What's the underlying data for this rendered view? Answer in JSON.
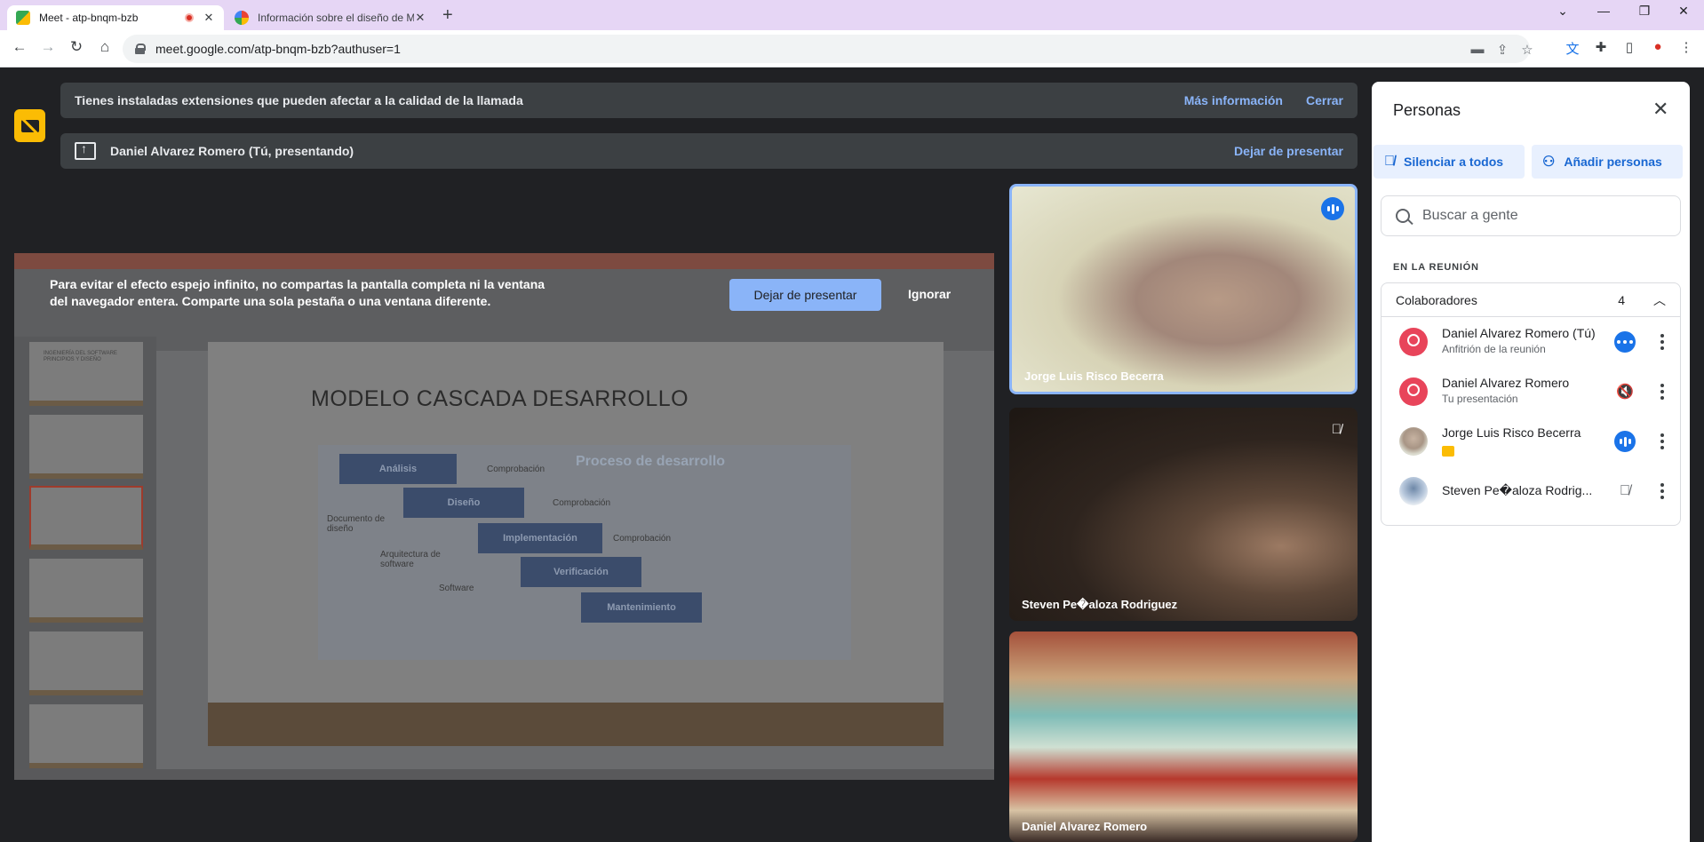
{
  "browser": {
    "tabs": [
      {
        "title": "Meet - atp-bnqm-bzb",
        "active": true,
        "recording": true
      },
      {
        "title": "Información sobre el diseño de M",
        "active": false
      }
    ],
    "new_tab_label": "+",
    "url": "meet.google.com/atp-bnqm-bzb?authuser=1",
    "window_controls": [
      "chevron-down",
      "minimize",
      "restore",
      "close"
    ]
  },
  "meet": {
    "extension_banner": {
      "message": "Tienes instaladas extensiones que pueden afectar a la calidad de la llamada",
      "more_info": "Más información",
      "close": "Cerrar"
    },
    "presenting_banner": {
      "message": "Daniel Alvarez Romero (Tú, presentando)",
      "stop": "Dejar de presentar"
    },
    "share_warning": {
      "message": "Para evitar el efecto espejo infinito, no compartas la pantalla completa ni la ventana del navegador entera. Comparte una sola pestaña o una ventana diferente.",
      "stop_button": "Dejar de presentar",
      "ignore_button": "Ignorar"
    },
    "shared_slide": {
      "title": "MODELO CASCADA DESARROLLO",
      "diagram_title": "Proceso de desarrollo",
      "steps": [
        "Análisis",
        "Diseño",
        "Implementación",
        "Verificación",
        "Mantenimiento"
      ],
      "labels": [
        "Comprobación",
        "Comprobación",
        "Comprobación",
        "Documento de diseño",
        "Arquitectura de software",
        "Software"
      ],
      "thumb_first_text": "INGENIERÍA DEL SOFTWARE PRINCIPIOS Y DISEÑO"
    },
    "tiles": [
      {
        "name": "Jorge Luis Risco Becerra",
        "speaking": true
      },
      {
        "name": "Steven Pe�aloza Rodriguez",
        "muted": true
      },
      {
        "name": "Daniel Alvarez Romero"
      }
    ]
  },
  "people_panel": {
    "title": "Personas",
    "mute_all": "Silenciar a todos",
    "add_people": "Añadir personas",
    "search_placeholder": "Buscar a gente",
    "section_label": "EN LA REUNIÓN",
    "group": {
      "name": "Colaboradores",
      "count": "4"
    },
    "participants": [
      {
        "name": "Daniel Alvarez Romero (Tú)",
        "subtitle": "Anfitrión de la reunión",
        "status": "more-dots"
      },
      {
        "name": "Daniel Alvarez Romero",
        "subtitle": "Tu presentación",
        "status": "volume-off"
      },
      {
        "name": "Jorge Luis Risco Becerra",
        "subtitle": "",
        "status": "speaking"
      },
      {
        "name": "Steven Pe�aloza Rodrig...",
        "subtitle": "",
        "status": "mic-off"
      }
    ]
  }
}
